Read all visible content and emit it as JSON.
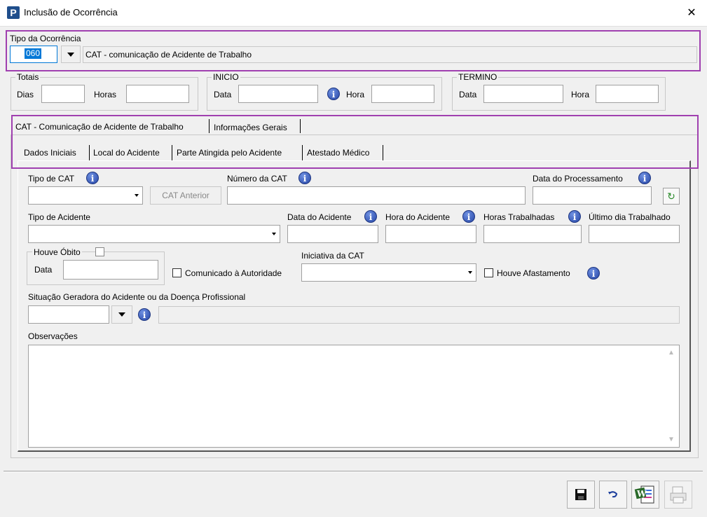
{
  "window": {
    "title": "Inclusão de Ocorrência",
    "close_glyph": "✕",
    "app_icon_letter": "P"
  },
  "tipo": {
    "label": "Tipo da Ocorrência",
    "code": "060",
    "description": "CAT - comunicação de Acidente de Trabalho"
  },
  "totais": {
    "title": "Totais",
    "dias": "Dias",
    "horas": "Horas"
  },
  "inicio": {
    "title": "INICIO",
    "data": "Data",
    "hora": "Hora"
  },
  "termino": {
    "title": "TERMINO",
    "data": "Data",
    "hora": "Hora"
  },
  "tabs": {
    "cat": "CAT - Comunicação de Acidente de Trabalho",
    "info": "Informações Gerais"
  },
  "subtabs": {
    "dados": "Dados Iniciais",
    "local": "Local do Acidente",
    "parte": "Parte Atingida pelo Acidente",
    "atestado": "Atestado Médico"
  },
  "form": {
    "tipo_cat": "Tipo de CAT",
    "cat_anterior": "CAT Anterior",
    "numero_cat": "Número da CAT",
    "data_processamento": "Data do Processamento",
    "tipo_acidente": "Tipo de Acidente",
    "data_acidente": "Data do Acidente",
    "hora_acidente": "Hora do Acidente",
    "horas_trabalhadas": "Horas Trabalhadas",
    "ultimo_dia": "Último dia Trabalhado",
    "houve_obito": "Houve Óbito",
    "data": "Data",
    "comunicado": "Comunicado à Autoridade",
    "iniciativa": "Iniciativa da CAT",
    "houve_afastamento": "Houve Afastamento",
    "situacao": "Situação Geradora do Acidente ou da Doença Profissional",
    "observacoes": "Observações"
  },
  "colors": {
    "highlight": "#a040b0",
    "info": "#2848a8",
    "selection": "#0078d7"
  },
  "icons": [
    "info-icon",
    "save-icon",
    "undo-icon",
    "word-icon",
    "print-icon",
    "refresh-icon"
  ]
}
